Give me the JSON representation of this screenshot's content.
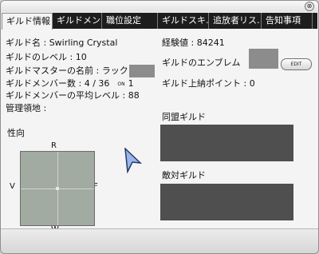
{
  "window": {
    "close_glyph": "⊗"
  },
  "tabs": [
    {
      "label": "ギルド情報",
      "active": true
    },
    {
      "label": "ギルドメン‥",
      "active": false
    },
    {
      "label": "職位設定",
      "active": false
    },
    {
      "label": "ギルドスキ‥",
      "active": false
    },
    {
      "label": "追放者リス‥",
      "active": false
    },
    {
      "label": "告知事項",
      "active": false
    }
  ],
  "info": {
    "guild_name": "ギルド名 : Swirling Crystal",
    "guild_level": "ギルドのレベル : 10",
    "master_name": "ギルドマスターの名前 : ラック",
    "members_label": "ギルドメンバー数 : 4 / 36",
    "online_tag": "ON",
    "online_count": "1",
    "avg_level": "ギルドメンバーの平均レベル : 88",
    "territory": "管理領地 :",
    "experience": "経験値 : 84241",
    "emblem_label": "ギルドのエンブレム",
    "edit_label": "EDIT",
    "tithe_points": "ギルド上納ポイント : 0"
  },
  "tendency": {
    "title": "性向",
    "top": "R",
    "bottom": "W",
    "left": "V",
    "right": "F"
  },
  "allied": {
    "title": "同盟ギルド"
  },
  "hostile": {
    "title": "敵対ギルド"
  }
}
